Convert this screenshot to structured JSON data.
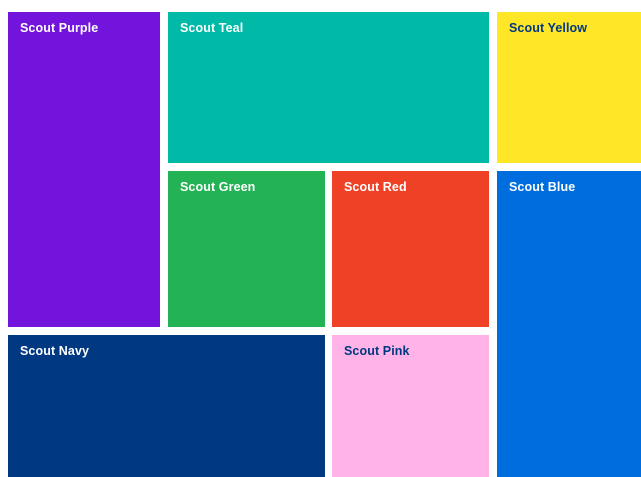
{
  "tiles": [
    {
      "id": "tile-purple",
      "label": "Scout Purple",
      "color": "#7214DC",
      "text_color": "#FFFFFF"
    },
    {
      "id": "tile-teal",
      "label": "Scout Teal",
      "color": "#00B9A6",
      "text_color": "#FFFFFF"
    },
    {
      "id": "tile-yellow",
      "label": "Scout Yellow",
      "color": "#FFE626",
      "text_color": "#003882"
    },
    {
      "id": "tile-green",
      "label": "Scout Green",
      "color": "#23B254",
      "text_color": "#FFFFFF"
    },
    {
      "id": "tile-red",
      "label": "Scout Red",
      "color": "#EF4125",
      "text_color": "#FFFFFF"
    },
    {
      "id": "tile-blue",
      "label": "Scout Blue",
      "color": "#006DDF",
      "text_color": "#FFFFFF"
    },
    {
      "id": "tile-navy",
      "label": "Scout Navy",
      "color": "#003882",
      "text_color": "#FFFFFF"
    },
    {
      "id": "tile-pink",
      "label": "Scout Pink",
      "color": "#FFB3E6",
      "text_color": "#003882"
    }
  ]
}
